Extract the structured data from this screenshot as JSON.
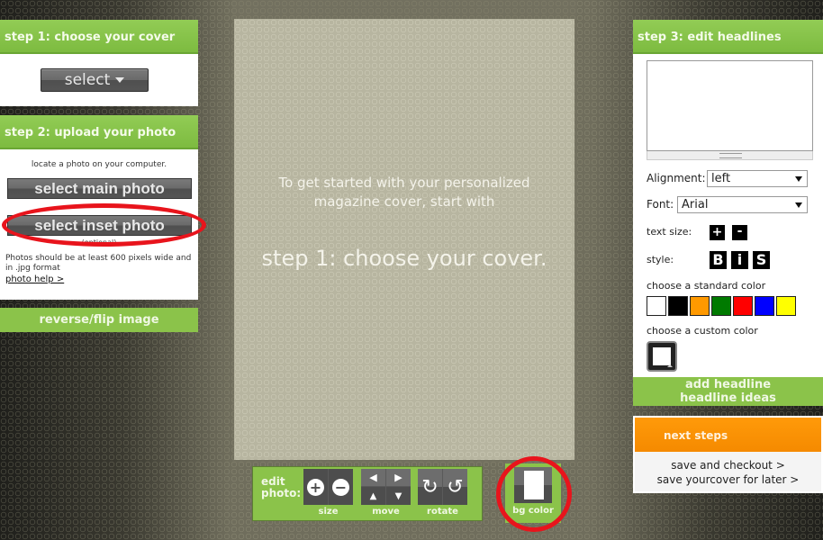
{
  "step1": {
    "title": "step 1: choose your cover",
    "select_label": "select"
  },
  "step2": {
    "title": "step 2: upload your photo",
    "hint": "locate a photo on your computer.",
    "main_photo_label": "select main photo",
    "inset_photo_label": "select inset photo",
    "optional": "(optional)",
    "note": "Photos should be at least 600 pixels wide and in .jpg format",
    "help_link": "photo help >"
  },
  "reverse_flip_label": "reverse/flip image",
  "canvas": {
    "intro": "To get started with your personalized magazine cover, start with",
    "call_to_action": "step 1: choose your cover."
  },
  "edit_toolbar": {
    "label": "edit photo:",
    "size_label": "size",
    "move_label": "move",
    "rotate_label": "rotate",
    "zoom_in_icon": "+",
    "zoom_out_icon": "−",
    "left_icon": "◀",
    "right_icon": "▶",
    "up_icon": "▲",
    "down_icon": "▼",
    "rotate_cw_icon": "↻",
    "rotate_ccw_icon": "↺"
  },
  "bg_color": {
    "label": "bg color",
    "value": "#ffffff"
  },
  "step3": {
    "title": "step 3: edit headlines",
    "headline_text": "",
    "alignment_label": "Alignment:",
    "alignment_value": "left",
    "font_label": "Font:",
    "font_value": "Arial",
    "text_size_label": "text size:",
    "text_size_plus": "+",
    "text_size_minus": "-",
    "style_label": "style:",
    "style_bold": "B",
    "style_italic": "i",
    "style_shadow": "S",
    "standard_color_label": "choose a standard color",
    "standard_colors": [
      "#ffffff",
      "#000000",
      "#ff9900",
      "#007a00",
      "#ff0000",
      "#0000ff",
      "#ffff00"
    ],
    "custom_color_label": "choose a custom color",
    "custom_color_value": "#ffffff",
    "add_headline": "add headline",
    "headline_ideas": "headline ideas"
  },
  "next_steps": {
    "title": "next steps",
    "save_checkout": "save and checkout >",
    "save_later": "save yourcover for later >"
  },
  "colors": {
    "accent_green": "#8bc34a",
    "accent_orange": "#f58a00",
    "highlight_red": "#e8141c"
  }
}
